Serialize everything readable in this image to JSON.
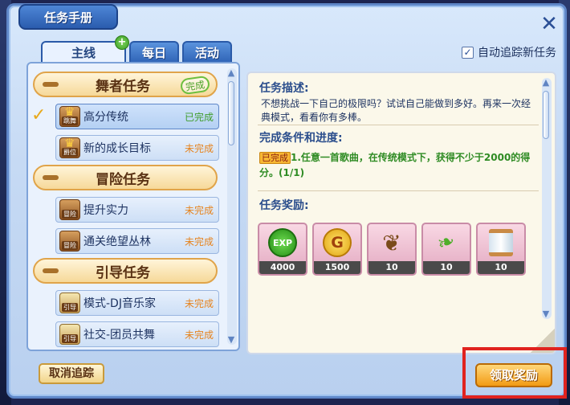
{
  "window": {
    "title": "任务手册",
    "close_icon": "close-icon"
  },
  "auto_track": {
    "label": "自动追踪新任务",
    "checked": true
  },
  "tabs": [
    {
      "label": "主线",
      "active": true,
      "has_new": true
    },
    {
      "label": "每日",
      "active": false
    },
    {
      "label": "活动",
      "active": false
    }
  ],
  "categories": [
    {
      "title": "舞者任务",
      "completed_stamp": "完成",
      "quests": [
        {
          "title": "高分传统",
          "status": "已完成",
          "icon_tag": "跳舞",
          "selected": true
        },
        {
          "title": "新的成长目标",
          "status": "未完成",
          "icon_tag": "爵位"
        }
      ]
    },
    {
      "title": "冒险任务",
      "quests": [
        {
          "title": "提升实力",
          "status": "未完成",
          "icon_tag": "冒险"
        },
        {
          "title": "通关绝望丛林",
          "status": "未完成",
          "icon_tag": "冒险"
        }
      ]
    },
    {
      "title": "引导任务",
      "quests": [
        {
          "title": "模式-DJ音乐家",
          "status": "未完成",
          "icon_tag": "引导"
        },
        {
          "title": "社交-团员共舞",
          "status": "未完成",
          "icon_tag": "引导"
        }
      ]
    }
  ],
  "detail": {
    "desc_title": "任务描述:",
    "desc_text": "不想挑战一下自己的极限吗？试试自己能做到多好。再来一次经典模式，看看你有多棒。",
    "cond_title": "完成条件和进度:",
    "cond_badge": "已完成",
    "cond_text": "1.任意一首歌曲，在传统模式下，获得不少于2000的得分。(1/1)",
    "reward_title": "任务奖励:",
    "rewards": [
      {
        "icon": "exp-icon",
        "label": "EXP",
        "count": "4000"
      },
      {
        "icon": "gold-coin-icon",
        "label": "G",
        "count": "1500"
      },
      {
        "icon": "seed-icon",
        "count": "10"
      },
      {
        "icon": "herb-icon",
        "count": "10"
      },
      {
        "icon": "spool-icon",
        "count": "10"
      }
    ]
  },
  "buttons": {
    "cancel_track": "取消追踪",
    "claim_reward": "领取奖励"
  }
}
